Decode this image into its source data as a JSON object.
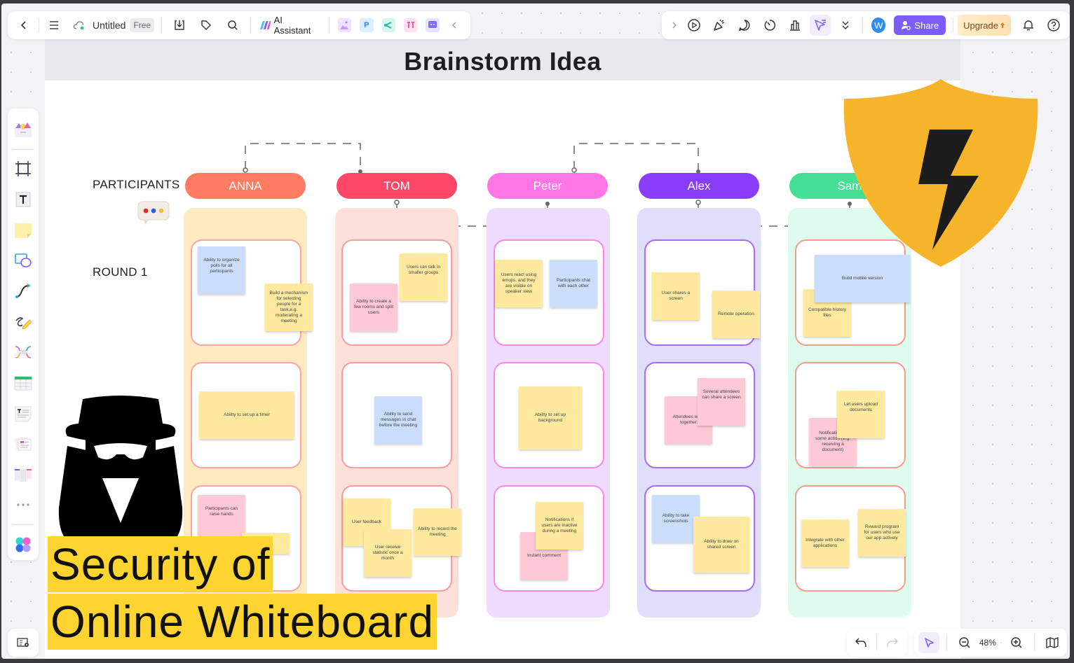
{
  "toolbar_left": {
    "back_icon": "chevron-left-icon",
    "menu_icon": "hamburger-icon",
    "cloud_icon": "cloud-sync-icon",
    "doc_title": "Untitled",
    "plan_badge": "Free",
    "ai_label": "AI Assistant",
    "apps": [
      "image-gen-app",
      "presentation-app",
      "mindmap-app",
      "flowchart-app",
      "chat-app"
    ],
    "presentation_letter": "P"
  },
  "toolbar_right": {
    "avatar_initial": "W",
    "share_label": "Share",
    "upgrade_label": "Upgrade"
  },
  "sidebar": {
    "items": [
      "templates",
      "frame",
      "text",
      "sticky-note",
      "shapes",
      "connector",
      "pen",
      "mind-map",
      "table",
      "text-doc",
      "cards",
      "kanban",
      "more",
      "apps"
    ]
  },
  "board": {
    "frame_title": "Brainstorm Idea",
    "participants_label": "PARTICIPANTS",
    "round_label": "ROUND  1",
    "participants": [
      {
        "name": "ANNA",
        "color": "#ff7b61",
        "lane": "#feeac0",
        "border": "#fca3a3"
      },
      {
        "name": "TOM",
        "color": "#fe4767",
        "lane": "#fde0d9",
        "border": "#fc9b9b"
      },
      {
        "name": "Peter",
        "color": "#ff75e4",
        "lane": "#eddcfd",
        "border": "#fd88e6"
      },
      {
        "name": "Alex",
        "color": "#8a3cfb",
        "lane": "#dfdefd",
        "border": "#a86bf8"
      },
      {
        "name": "Sam",
        "color": "#44df94",
        "lane": "#ddfced",
        "border": "#f59d8d"
      }
    ],
    "notes": {
      "anna": [
        "Ability to organize polls for all participants",
        "Build a mechanism for selecting people for a task,e.g. moderating a meeting",
        "Ability to set up a timer",
        "Participants can raise hands"
      ],
      "tom": [
        "Ability to create a few rooms and split users",
        "Users can talk in smaller groups",
        "Ability to send messages in chat before the meeting",
        "User feedback",
        "User receive statistic once a month",
        "Ability to record the meeting"
      ],
      "peter": [
        "Users react using emojis, and they are visible on speaker view",
        "Participants chat with each other",
        "Ability to set up background",
        "Instant comment",
        "Notifications if users are inactive during a meeting"
      ],
      "alex": [
        "User shares a screen",
        "Remote operation",
        "Attendees work together",
        "Several attendees can share a screen",
        "Ability to take screenshots",
        "Ability to draw on shared screen"
      ],
      "sam": [
        "Compatible history files",
        "Build mobile version",
        "Notification of some action (e.g. receiving a document)",
        "Let users upload documents",
        "Integrate with other applications",
        "Reward program for users who use our app actively"
      ]
    }
  },
  "overlay": {
    "title_line1": "Security of",
    "title_line2": "Online Whiteboard",
    "shield_color": "#f6b42b",
    "highlight_color": "#fed530"
  },
  "bottom_bar": {
    "zoom_level": "48%"
  }
}
